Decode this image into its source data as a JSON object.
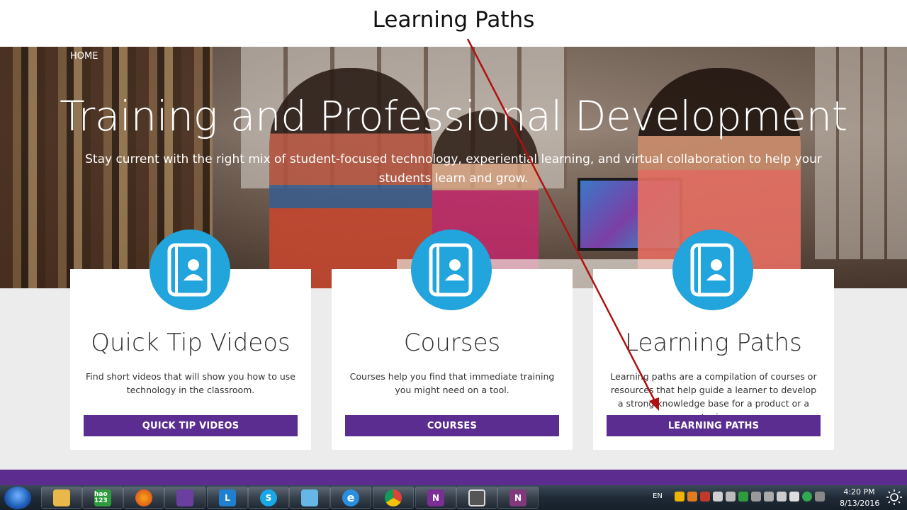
{
  "slide": {
    "title": "Learning Paths"
  },
  "hero": {
    "breadcrumb": "HOME",
    "title": "Training and Professional Development",
    "subtitle": "Stay current with the right mix of student-focused technology, experiential learning, and virtual collaboration to help your students learn and grow."
  },
  "cards": [
    {
      "icon": "contact-book-icon",
      "title": "Quick Tip Videos",
      "description": "Find short videos that will show you how to use technology in the classroom.",
      "button": "QUICK TIP VIDEOS"
    },
    {
      "icon": "contact-book-icon",
      "title": "Courses",
      "description": "Courses help you find that immediate training you might need on a tool.",
      "button": "COURSES"
    },
    {
      "icon": "contact-book-icon",
      "title": "Learning Paths",
      "description": "Learning paths are a compilation of courses or resources that help guide a learner to develop a strong knowledge base for a product or a topic.",
      "button": "LEARNING PATHS"
    }
  ],
  "colors": {
    "accent_purple": "#5c2d91",
    "icon_blue": "#22a4dd",
    "annotation_arrow": "#b01010"
  },
  "taskbar": {
    "apps": [
      {
        "icon": "file-explorer-icon",
        "label": ""
      },
      {
        "icon": "hao123-icon",
        "label": "hao 123"
      },
      {
        "icon": "firefox-icon",
        "label": ""
      },
      {
        "icon": "visual-studio-icon",
        "label": ""
      },
      {
        "icon": "lync-icon",
        "label": "L"
      },
      {
        "icon": "skype-icon",
        "label": "S"
      },
      {
        "icon": "network-sync-icon",
        "label": ""
      },
      {
        "icon": "internet-explorer-icon",
        "label": "e"
      },
      {
        "icon": "chrome-icon",
        "label": ""
      },
      {
        "icon": "onenote-clipper-icon",
        "label": "N"
      },
      {
        "icon": "movie-maker-icon",
        "label": ""
      },
      {
        "icon": "onenote-icon",
        "label": "N"
      }
    ],
    "language": "EN",
    "time": "4:20 PM",
    "date": "8/13/2016"
  }
}
